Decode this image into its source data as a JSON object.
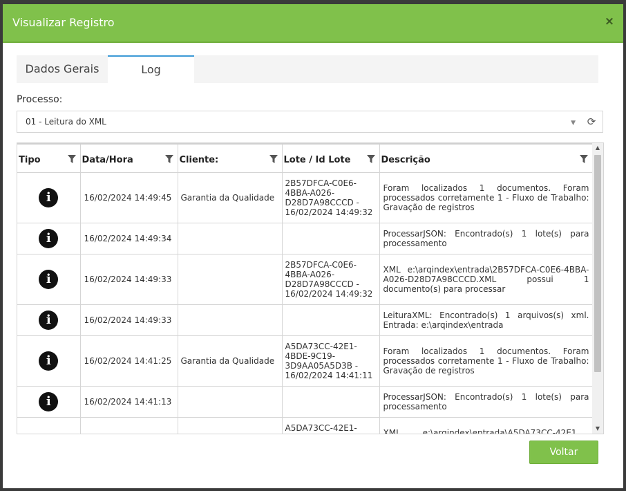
{
  "modal": {
    "title": "Visualizar Registro",
    "close_label": "×"
  },
  "tabs": [
    {
      "label": "Dados Gerais",
      "active": false
    },
    {
      "label": "Log",
      "active": true
    }
  ],
  "processo": {
    "label": "Processo:",
    "selected": "01 - Leitura do XML",
    "refresh_icon": "refresh-icon"
  },
  "grid": {
    "columns": [
      "Tipo",
      "Data/Hora",
      "Cliente:",
      "Lote / Id Lote",
      "Descrição"
    ],
    "rows": [
      {
        "tipo": "i",
        "data": "16/02/2024 14:49:45",
        "cliente": "Garantia da Qualidade",
        "lote": "2B57DFCA-C0E6-4BBA-A026-D28D7A98CCCD - 16/02/2024 14:49:32",
        "descricao": "Foram localizados 1 documentos. Foram processados corretamente 1 - Fluxo de Trabalho: Gravação de registros"
      },
      {
        "tipo": "i",
        "data": "16/02/2024 14:49:34",
        "cliente": "",
        "lote": "",
        "descricao": "ProcessarJSON: Encontrado(s) 1 lote(s) para processamento"
      },
      {
        "tipo": "i",
        "data": "16/02/2024 14:49:33",
        "cliente": "",
        "lote": "2B57DFCA-C0E6-4BBA-A026-D28D7A98CCCD - 16/02/2024 14:49:32",
        "descricao": "XML e:\\arqindex\\entrada\\2B57DFCA-C0E6-4BBA-A026-D28D7A98CCCD.XML possui 1 documento(s) para processar"
      },
      {
        "tipo": "i",
        "data": "16/02/2024 14:49:33",
        "cliente": "",
        "lote": "",
        "descricao": "LeituraXML: Encontrado(s) 1 arquivos(s) xml. Entrada: e:\\arqindex\\entrada"
      },
      {
        "tipo": "i",
        "data": "16/02/2024 14:41:25",
        "cliente": "Garantia da Qualidade",
        "lote": "A5DA73CC-42E1-4BDE-9C19-3D9AA05A5D3B - 16/02/2024 14:41:11",
        "descricao": "Foram localizados 1 documentos. Foram processados corretamente 1 - Fluxo de Trabalho: Gravação de registros"
      },
      {
        "tipo": "i",
        "data": "16/02/2024 14:41:13",
        "cliente": "",
        "lote": "",
        "descricao": "ProcessarJSON: Encontrado(s) 1 lote(s) para processamento"
      },
      {
        "tipo": "",
        "data": "",
        "cliente": "",
        "lote": "A5DA73CC-42E1-",
        "descricao": "XML e:\\arqindex\\entrada\\A5DA73CC-42E1"
      }
    ]
  },
  "footer": {
    "voltar_label": "Voltar"
  },
  "colors": {
    "header_green": "#80c14b",
    "tab_active_border": "#3c9ad6"
  }
}
